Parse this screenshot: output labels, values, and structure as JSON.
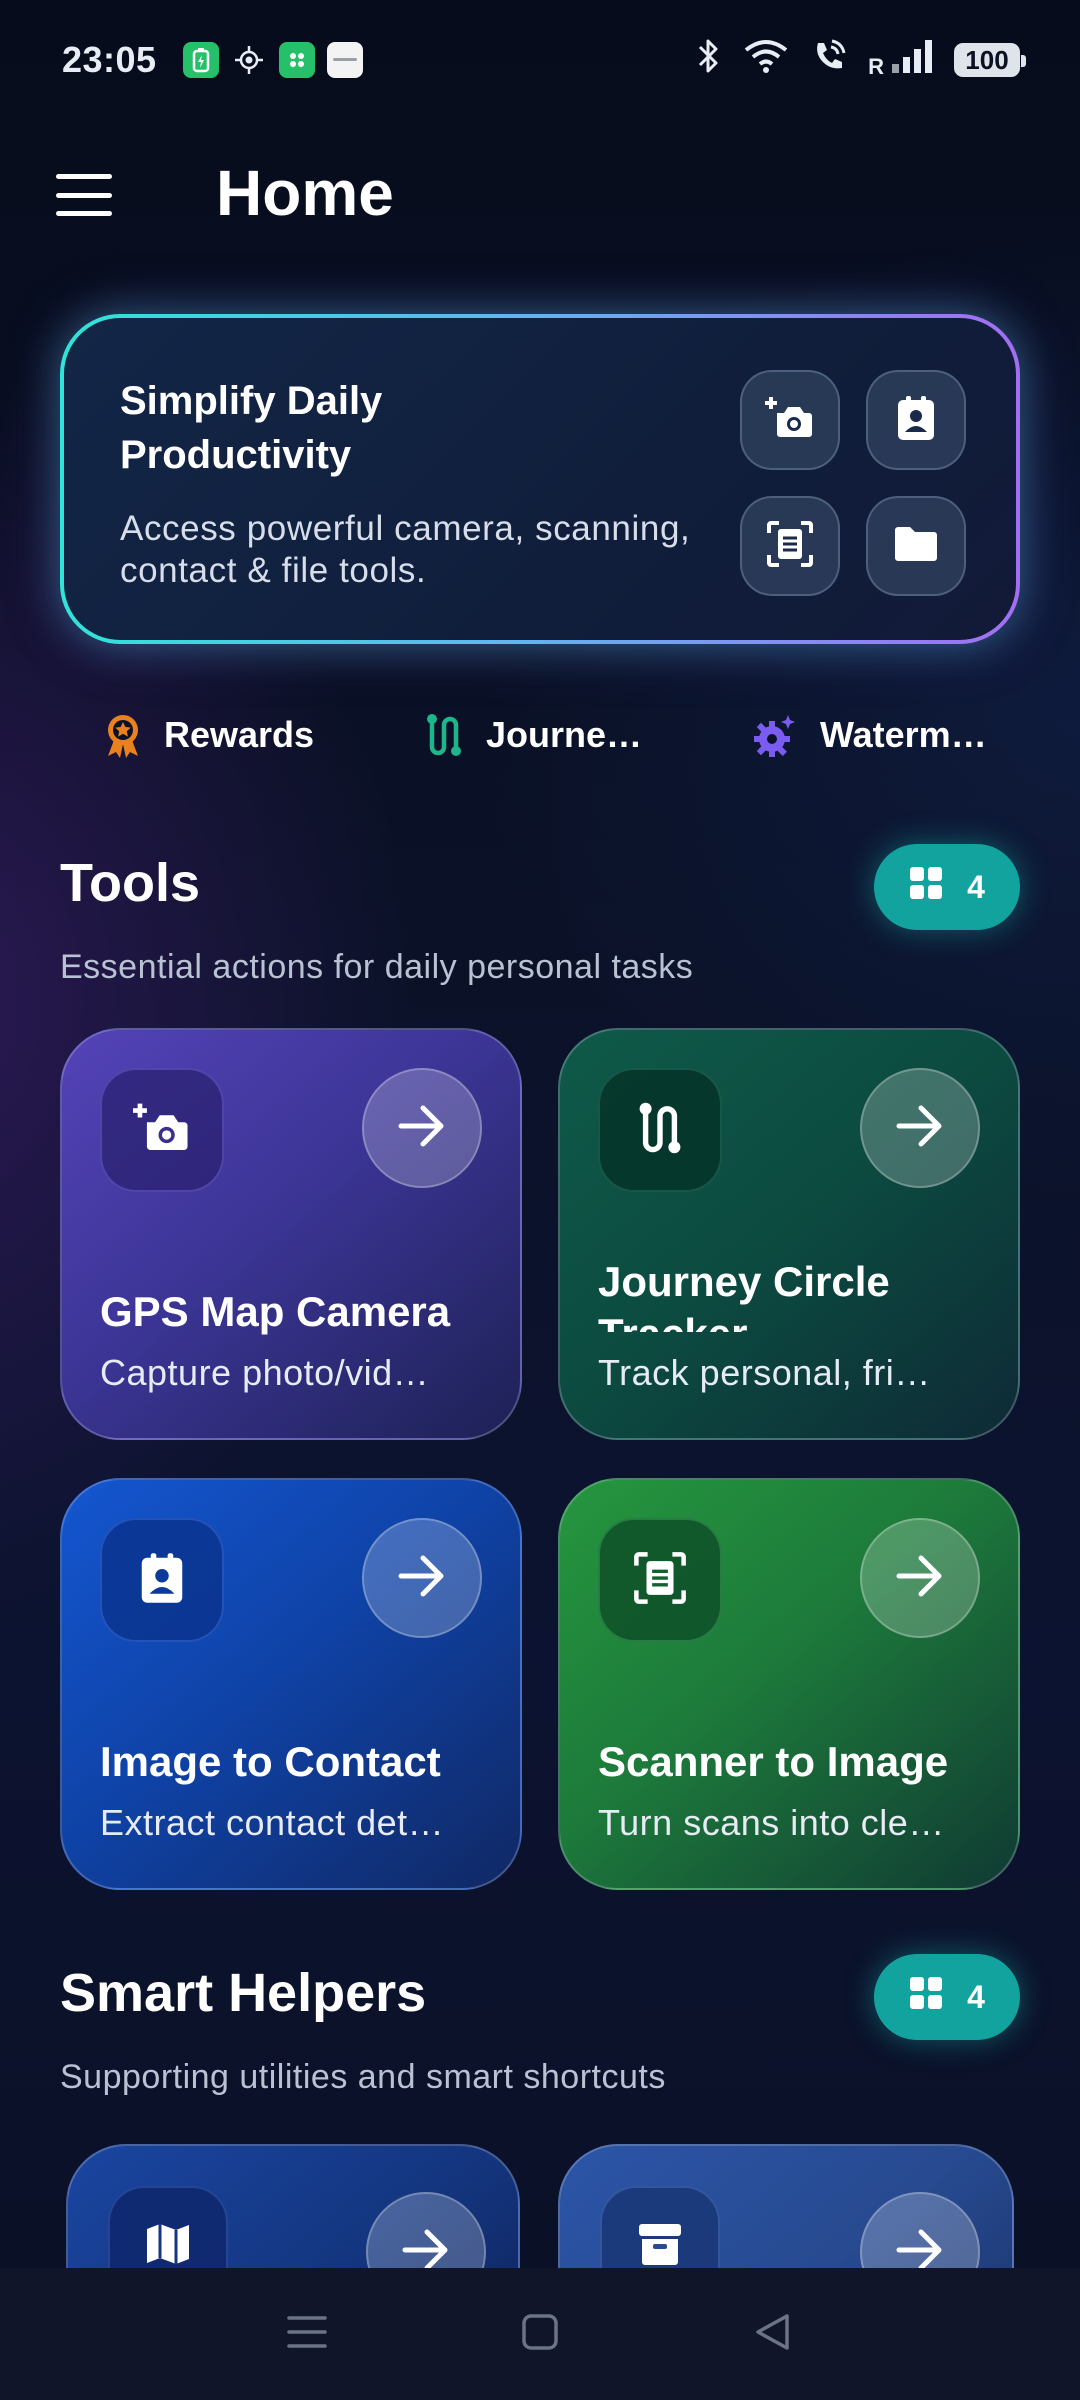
{
  "status_bar": {
    "time": "23:05",
    "battery": "100",
    "signal_label": "R"
  },
  "app_bar": {
    "title": "Home"
  },
  "hero": {
    "title": "Simplify Daily Productivity",
    "subtitle": "Access powerful camera, scanning, contact & file tools."
  },
  "quick_links": [
    {
      "label": "Rewards",
      "icon": "rewards-badge-icon"
    },
    {
      "label": "Journe…",
      "icon": "route-icon"
    },
    {
      "label": "Waterm…",
      "icon": "gear-sparkle-icon"
    }
  ],
  "tools": {
    "title": "Tools",
    "subtitle": "Essential actions for daily personal tasks",
    "count": "4",
    "cards": [
      {
        "title": "GPS Map Camera",
        "subtitle": "Capture photo/vid…"
      },
      {
        "title": "Journey Circle Tracker",
        "subtitle": "Track personal, fri…"
      },
      {
        "title": "Image to Contact",
        "subtitle": "Extract contact det…"
      },
      {
        "title": "Scanner to Image",
        "subtitle": "Turn scans into cle…"
      }
    ]
  },
  "smart_helpers": {
    "title": "Smart Helpers",
    "subtitle": "Supporting utilities and smart shortcuts",
    "count": "4"
  },
  "colors": {
    "accent_teal": "#12a39e",
    "card_purple": "#5443b8",
    "card_teal": "#0f5a49",
    "card_blue": "#1456d0",
    "card_green": "#25963e"
  }
}
